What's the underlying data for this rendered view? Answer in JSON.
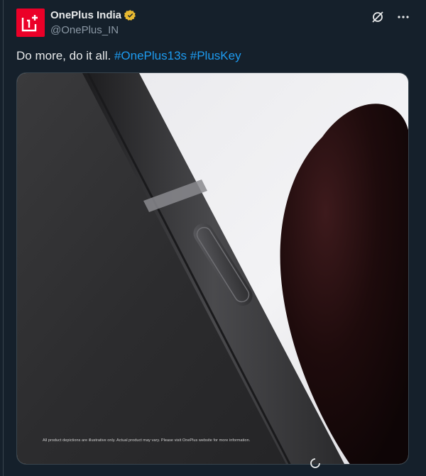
{
  "account": {
    "display_name": "OnePlus India",
    "handle": "@OnePlus_IN",
    "verified_badge_color": "#e8b931"
  },
  "icons": {
    "brand_logo": "oneplus-logo-icon",
    "verified": "verified-badge-icon",
    "grok": "grok-icon",
    "more": "more-options-icon"
  },
  "tweet": {
    "text": "Do more, do it all. ",
    "hashtags": [
      "#OnePlus13s",
      "#PlusKey"
    ]
  },
  "media": {
    "disclaimer": "All product depictions are illustrative only. Actual product may vary. Please visit OnePlus website for more information."
  },
  "colors": {
    "background": "#15202b",
    "text": "#e7e9ea",
    "secondary_text": "#8b98a5",
    "link": "#1d9bf0",
    "brand_red": "#eb0028"
  }
}
